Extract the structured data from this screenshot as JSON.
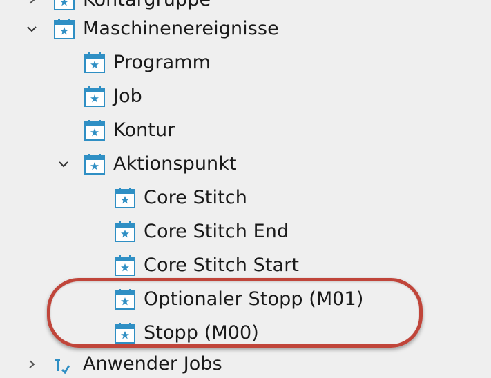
{
  "tree": {
    "items": [
      {
        "label": "Kontargruppe",
        "icon": "calendar-star-icon",
        "expanded": false
      },
      {
        "label": "Maschinenereignisse",
        "icon": "calendar-star-icon",
        "expanded": true
      },
      {
        "label": "Programm",
        "icon": "calendar-star-icon"
      },
      {
        "label": "Job",
        "icon": "calendar-star-icon"
      },
      {
        "label": "Kontur",
        "icon": "calendar-star-icon"
      },
      {
        "label": "Aktionspunkt",
        "icon": "calendar-star-icon",
        "expanded": true
      },
      {
        "label": "Core Stitch",
        "icon": "calendar-star-icon"
      },
      {
        "label": "Core Stitch End",
        "icon": "calendar-star-icon"
      },
      {
        "label": "Core Stitch Start",
        "icon": "calendar-star-icon"
      },
      {
        "label": "Optionaler Stopp (M01)",
        "icon": "calendar-star-icon"
      },
      {
        "label": "Stopp (M00)",
        "icon": "calendar-star-icon"
      },
      {
        "label": "Anwender Jobs",
        "icon": "user-jobs-icon",
        "expanded": false
      }
    ]
  },
  "colors": {
    "background": "#efefef",
    "icon_blue": "#2f8fc4",
    "highlight_ring": "#c0453a"
  }
}
